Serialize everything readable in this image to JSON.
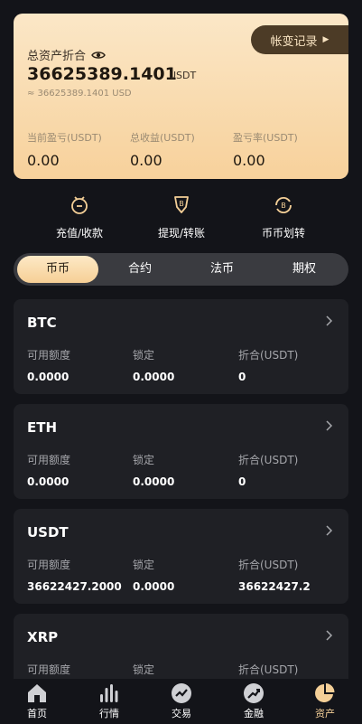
{
  "summary": {
    "title": "总资产折合",
    "record_button": "帐变记录",
    "total_value": "36625389.1401",
    "total_unit": "USDT",
    "approx_value": "≈ 36625389.1401 USD",
    "metrics": [
      {
        "label": "当前盈亏(USDT)",
        "value": "0.00"
      },
      {
        "label": "总收益(USDT)",
        "value": "0.00"
      },
      {
        "label": "盈亏率(USDT)",
        "value": "0.00"
      }
    ]
  },
  "actions": [
    {
      "label": "充值/收款",
      "icon": "deposit-icon"
    },
    {
      "label": "提现/转账",
      "icon": "withdraw-icon"
    },
    {
      "label": "币币划转",
      "icon": "transfer-icon"
    }
  ],
  "tabs": [
    {
      "label": "币币",
      "active": true
    },
    {
      "label": "合约",
      "active": false
    },
    {
      "label": "法币",
      "active": false
    },
    {
      "label": "期权",
      "active": false
    }
  ],
  "asset_columns": [
    "可用额度",
    "锁定",
    "折合(USDT)"
  ],
  "assets": [
    {
      "name": "BTC",
      "available": "0.0000",
      "locked": "0.0000",
      "converted": "0"
    },
    {
      "name": "ETH",
      "available": "0.0000",
      "locked": "0.0000",
      "converted": "0"
    },
    {
      "name": "USDT",
      "available": "36622427.2000",
      "locked": "0.0000",
      "converted": "36622427.2"
    },
    {
      "name": "XRP",
      "available": "",
      "locked": "",
      "converted": ""
    }
  ],
  "nav": [
    {
      "label": "首页",
      "icon": "home-icon",
      "active": false
    },
    {
      "label": "行情",
      "icon": "market-icon",
      "active": false
    },
    {
      "label": "交易",
      "icon": "trade-icon",
      "active": false
    },
    {
      "label": "金融",
      "icon": "finance-icon",
      "active": false
    },
    {
      "label": "资产",
      "icon": "assets-icon",
      "active": true
    }
  ],
  "colors": {
    "accent": "#f4cf97",
    "background": "#131419",
    "card": "#1f2025"
  }
}
